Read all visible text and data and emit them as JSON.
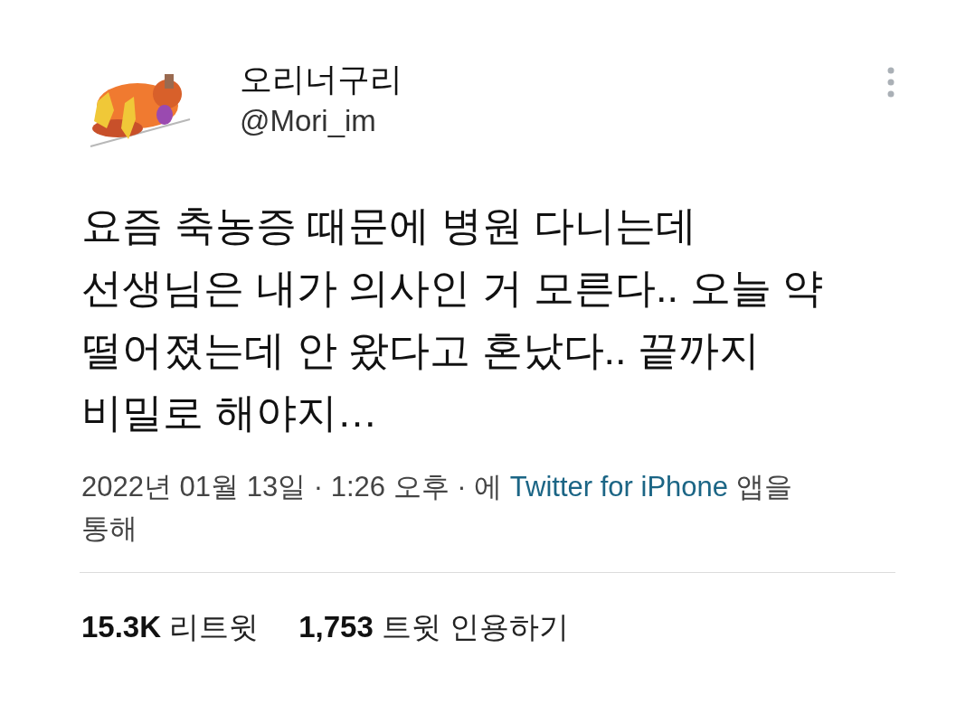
{
  "author": {
    "display_name": "오리너구리",
    "handle": "@Mori_im"
  },
  "body_lines": [
    {
      "text": "요즘 축농증 때문에 병원 다니는데"
    },
    {
      "text": "선생님은 내가 의사인 거 모른다.. 오늘 약"
    },
    {
      "text": "떨어졌는데 안 왔다고 혼났다.. 끝까지"
    },
    {
      "text": "비밀로 해야지…"
    }
  ],
  "meta_lines": [
    {
      "parts": [
        {
          "kind": "plain",
          "text": "2022년 01월 13일 · 1:26 오후 · 에 "
        },
        {
          "kind": "link",
          "text": "Twitter for iPhone"
        },
        {
          "kind": "plain",
          "text": " 앱을"
        }
      ]
    },
    {
      "parts": [
        {
          "kind": "plain",
          "text": "통해"
        }
      ]
    }
  ],
  "stats": {
    "items": [
      {
        "count": "15.3K",
        "caption": "리트윗"
      },
      {
        "count": "1,753",
        "caption": "트윗 인용하기"
      }
    ]
  }
}
